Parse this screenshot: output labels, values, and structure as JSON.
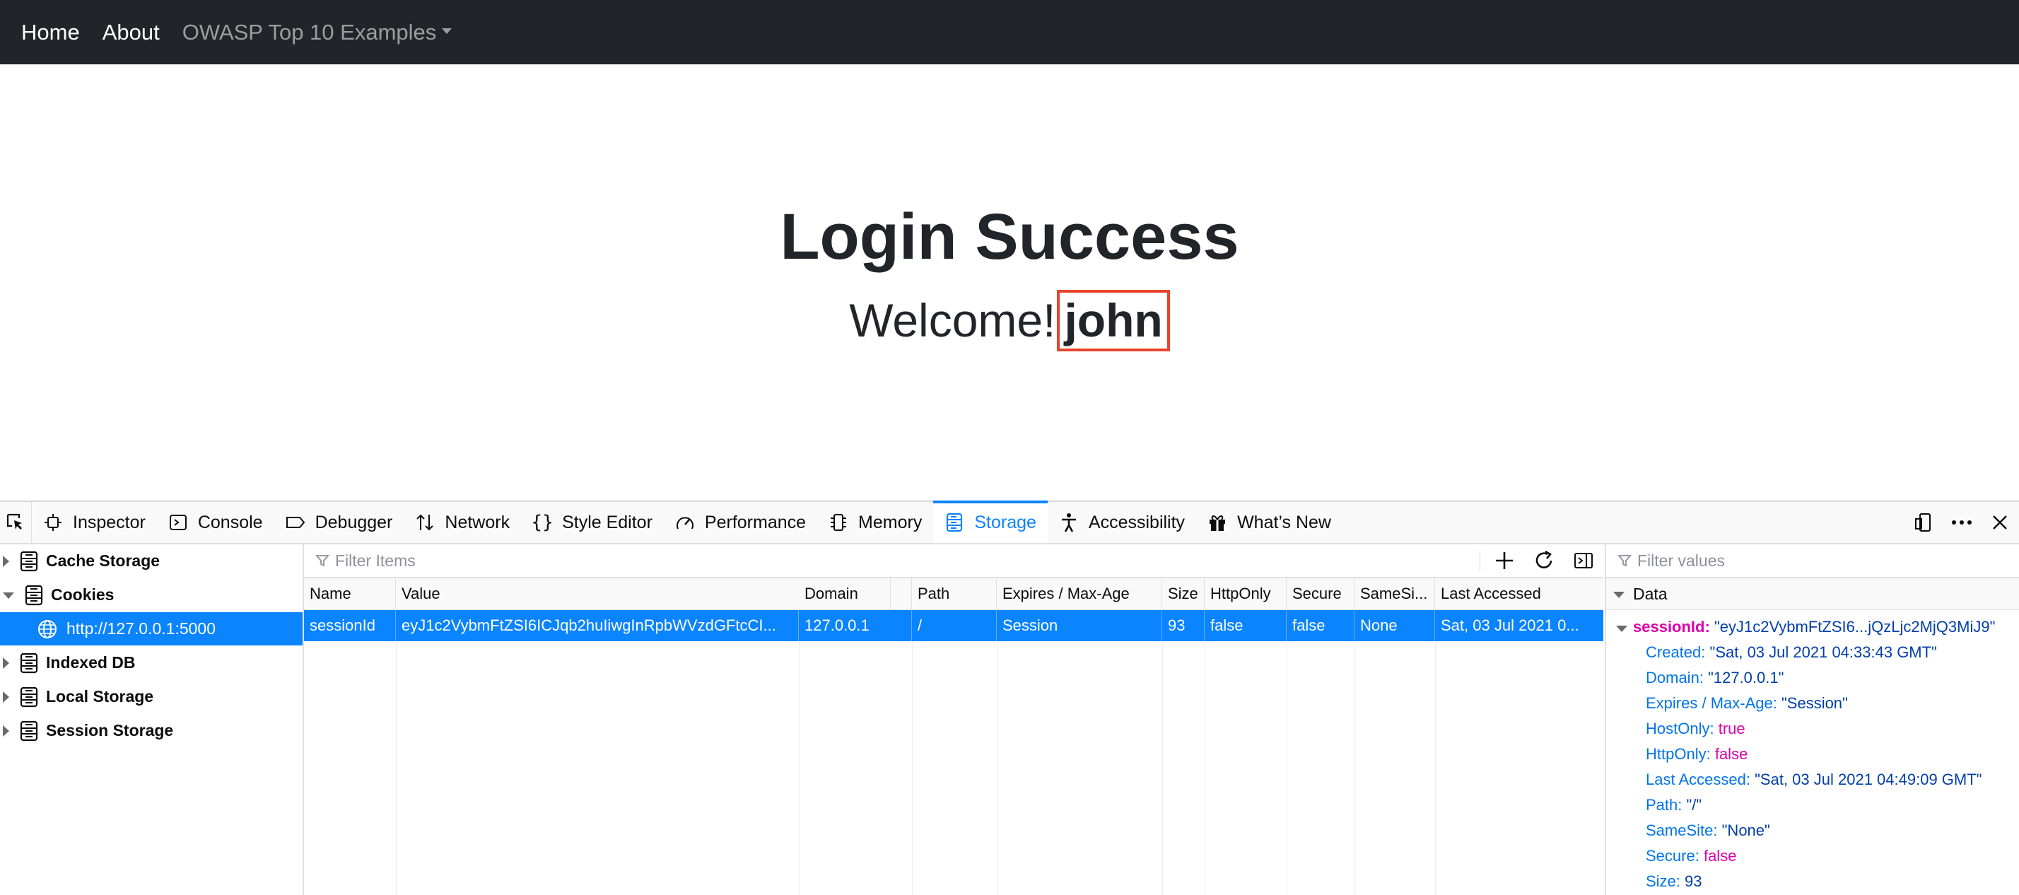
{
  "navbar": {
    "home": "Home",
    "about": "About",
    "examples": "OWASP Top 10 Examples"
  },
  "page": {
    "title": "Login Success",
    "welcome": "Welcome!",
    "username": "john"
  },
  "devtools": {
    "tabs": [
      {
        "label": "Inspector",
        "icon": "inspector-icon"
      },
      {
        "label": "Console",
        "icon": "console-icon"
      },
      {
        "label": "Debugger",
        "icon": "debugger-icon"
      },
      {
        "label": "Network",
        "icon": "network-icon"
      },
      {
        "label": "Style Editor",
        "icon": "style-editor-icon"
      },
      {
        "label": "Performance",
        "icon": "performance-icon"
      },
      {
        "label": "Memory",
        "icon": "memory-icon"
      },
      {
        "label": "Storage",
        "icon": "storage-icon"
      },
      {
        "label": "Accessibility",
        "icon": "accessibility-icon"
      },
      {
        "label": "What’s New",
        "icon": "gift-icon"
      }
    ],
    "selected_tab": "Storage",
    "accent_color": "#0a84ff",
    "sidebar": {
      "items": [
        {
          "label": "Cache Storage"
        },
        {
          "label": "Cookies"
        },
        {
          "label": "http://127.0.0.1:5000"
        },
        {
          "label": "Indexed DB"
        },
        {
          "label": "Local Storage"
        },
        {
          "label": "Session Storage"
        }
      ]
    },
    "table": {
      "filter_placeholder": "Filter Items",
      "columns": [
        "Name",
        "Value",
        "Domain",
        "Path",
        "Expires / Max-Age",
        "Size",
        "HttpOnly",
        "Secure",
        "SameSi...",
        "Last Accessed"
      ],
      "row": [
        "sessionId",
        "eyJ1c2VybmFtZSI6ICJqb2huIiwgInRpbWVzdGFtcCI...",
        "127.0.0.1",
        "/",
        "Session",
        "93",
        "false",
        "false",
        "None",
        "Sat, 03 Jul 2021 0..."
      ]
    },
    "data_panel": {
      "filter_placeholder": "Filter values",
      "header": "Data",
      "root_key": "sessionId",
      "root_value": "\"eyJ1c2VybmFtZSI6...jQzLjc2MjQ3MiJ9\"",
      "fields": [
        {
          "key": "Created",
          "value": "\"Sat, 03 Jul 2021 04:33:43 GMT\"",
          "type": "s"
        },
        {
          "key": "Domain",
          "value": "\"127.0.0.1\"",
          "type": "s"
        },
        {
          "key": "Expires / Max-Age",
          "value": "\"Session\"",
          "type": "s"
        },
        {
          "key": "HostOnly",
          "value": "true",
          "type": "b"
        },
        {
          "key": "HttpOnly",
          "value": "false",
          "type": "b"
        },
        {
          "key": "Last Accessed",
          "value": "\"Sat, 03 Jul 2021 04:49:09 GMT\"",
          "type": "s"
        },
        {
          "key": "Path",
          "value": "\"/\"",
          "type": "s"
        },
        {
          "key": "SameSite",
          "value": "\"None\"",
          "type": "s"
        },
        {
          "key": "Secure",
          "value": "false",
          "type": "b"
        },
        {
          "key": "Size",
          "value": "93",
          "type": "n"
        }
      ]
    }
  }
}
